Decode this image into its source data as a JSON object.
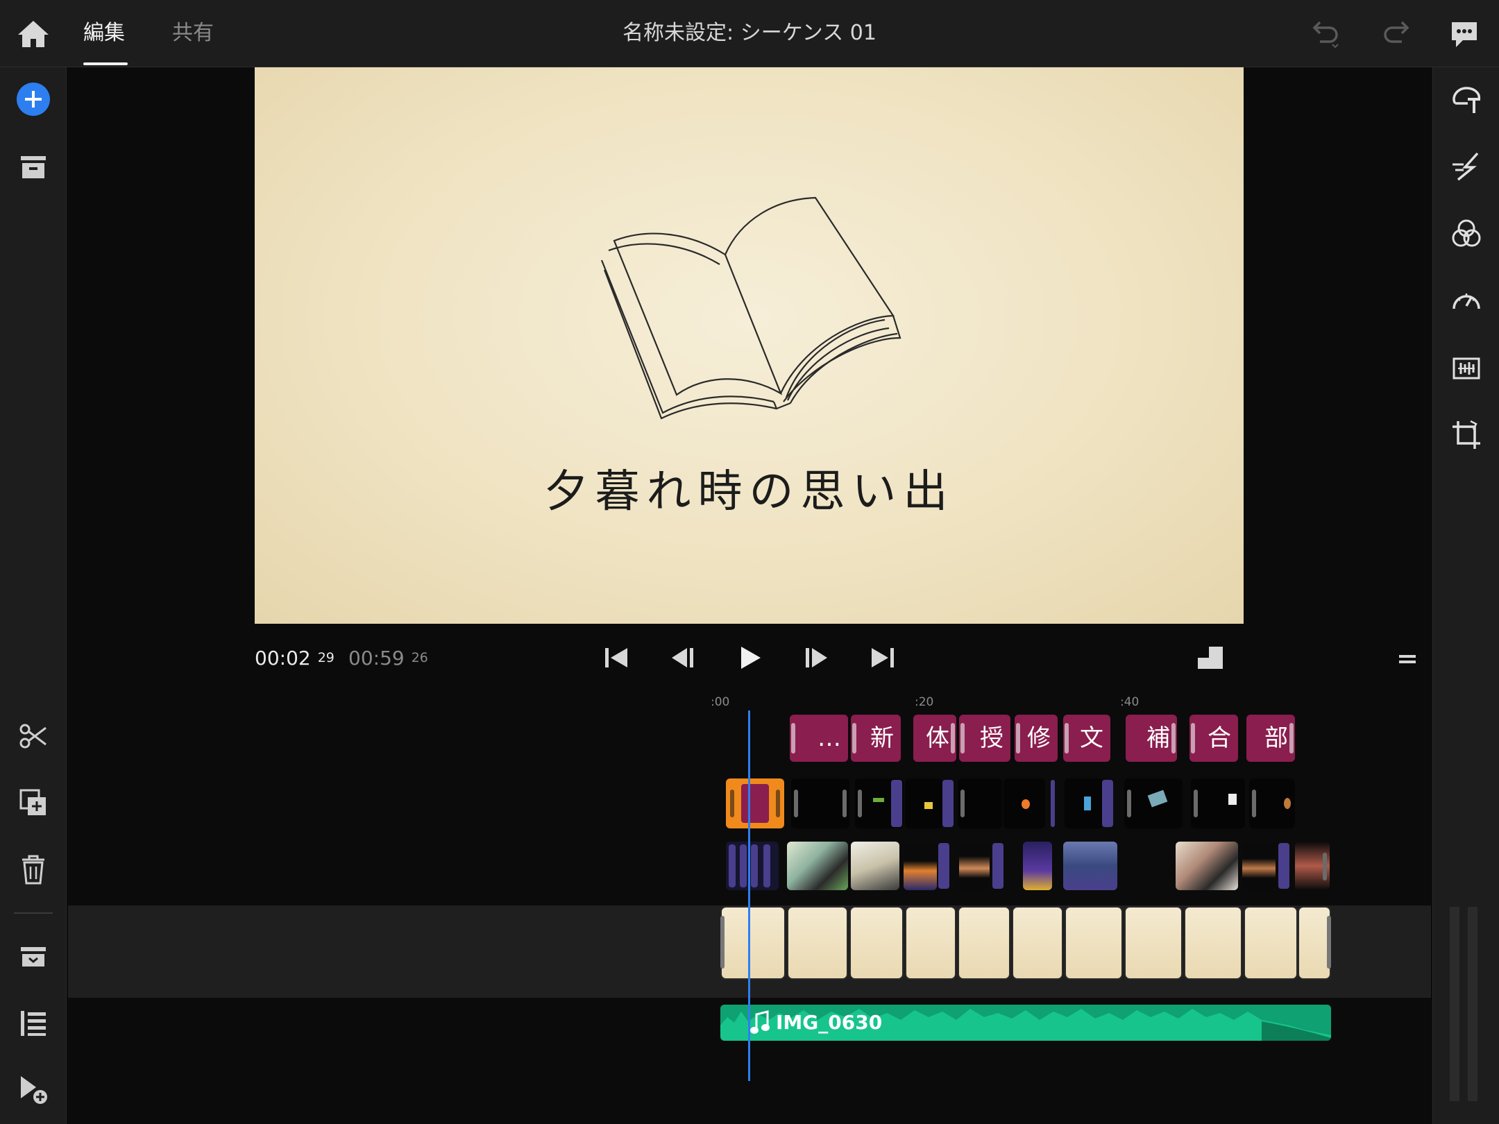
{
  "header": {
    "tabs": [
      {
        "label": "編集",
        "active": true
      },
      {
        "label": "共有",
        "active": false
      }
    ],
    "sequence_title": "名称未設定: シーケンス 01"
  },
  "viewer": {
    "caption": "夕暮れ時の思い出"
  },
  "transport": {
    "current_time": "00:02",
    "current_frames": "29",
    "duration_time": "00:59",
    "duration_frames": "26"
  },
  "timeline": {
    "ruler_labels": [
      ":00",
      ":20",
      ":40"
    ],
    "title_clips": [
      "…",
      "新",
      "体",
      "授",
      "修",
      "文",
      "補",
      "合",
      "部"
    ],
    "audio_clip_name": "IMG_0630"
  },
  "colors": {
    "accent_blue": "#2d7ff0",
    "title_clip": "#8a1e4e",
    "selected_clip": "#f08a1c",
    "audio_clip": "#17c58c",
    "transition": "#4a3f8c"
  },
  "icons": {
    "left_rail": [
      "add-media-icon",
      "project-panel-icon",
      "split-icon",
      "duplicate-icon",
      "delete-icon",
      "archive-icon",
      "track-list-icon",
      "add-track-icon"
    ],
    "right_rail": [
      "titles-icon",
      "transitions-icon",
      "color-icon",
      "speed-icon",
      "audio-icon",
      "crop-icon"
    ],
    "top_right": [
      "undo-icon",
      "redo-icon",
      "feedback-icon"
    ]
  }
}
